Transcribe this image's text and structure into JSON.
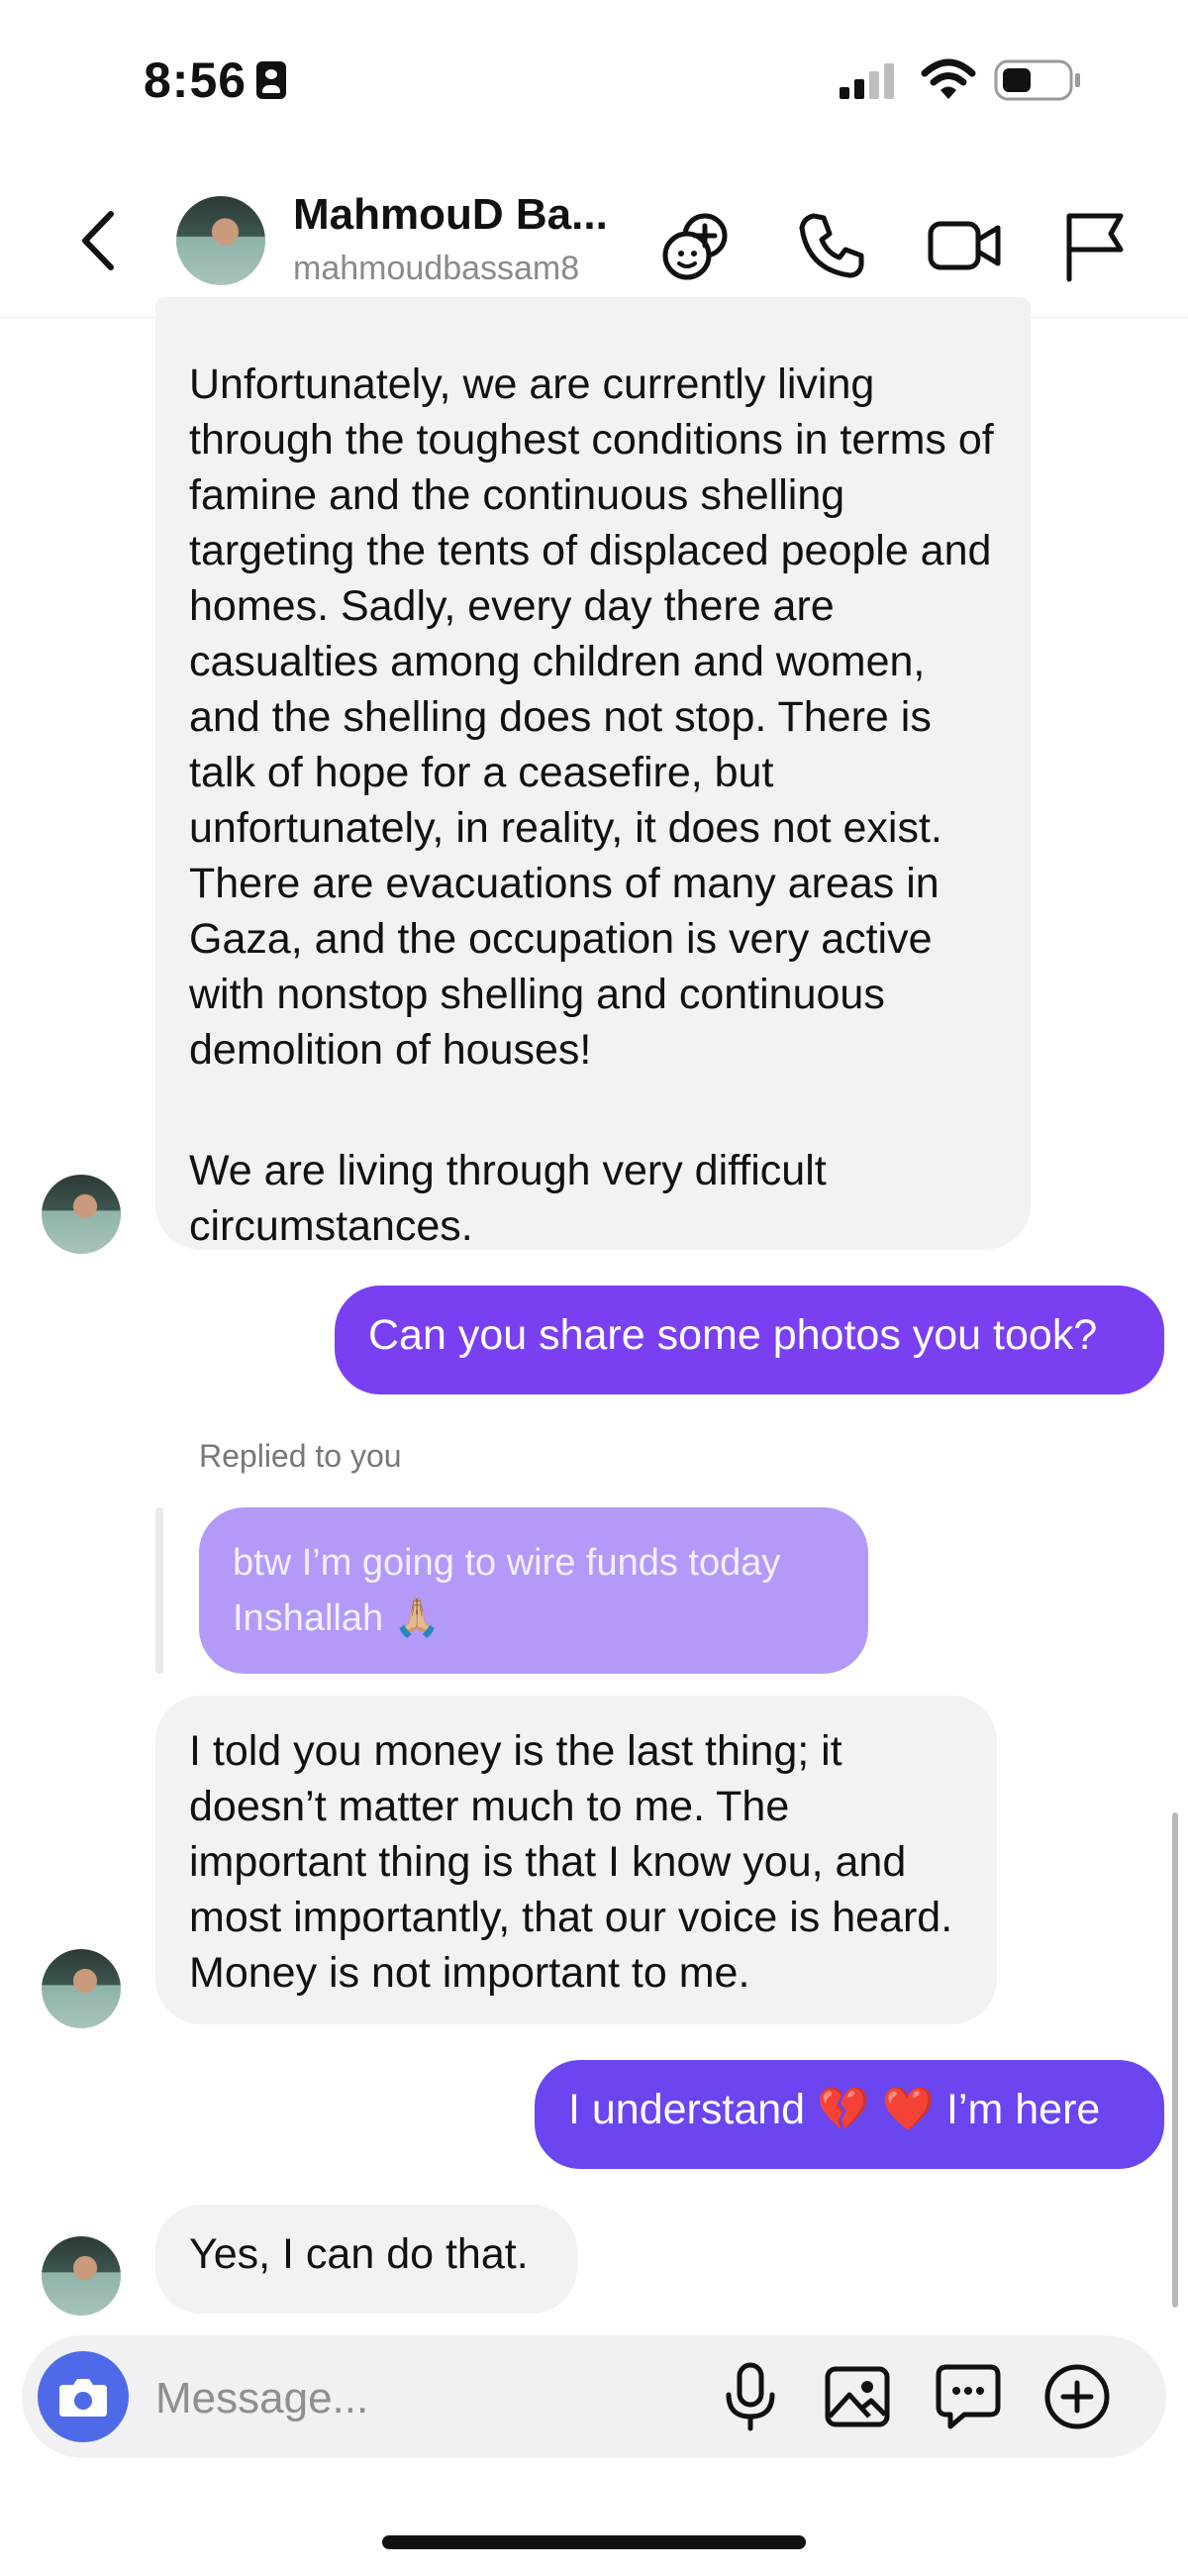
{
  "status_bar": {
    "time": "8:56"
  },
  "header": {
    "display_name": "MahmouD Ba...",
    "username": "mahmoudbassam8",
    "icons": [
      "back-chevron-icon",
      "add-person-icon",
      "phone-icon",
      "video-camera-icon",
      "flag-icon"
    ]
  },
  "messages": {
    "m1_p1": "Unfortunately, we are currently living through the toughest conditions in terms of famine and the continuous shelling targeting the tents of displaced people and homes. Sadly, every day there are casualties among children and women, and the shelling does not stop. There is talk of hope for a ceasefire, but unfortunately, in reality, it does not exist. There are evacuations of many areas in Gaza, and the occupation is very active with nonstop shelling and continuous demolition of houses!",
    "m1_p2": "We are living through very difficult circumstances.",
    "m2": "Can you share some photos you took?",
    "reply_label": "Replied to you",
    "reply_quote": "btw I’m going to wire funds today Inshallah 🙏🏼",
    "m3": "I told you money is the last thing; it doesn’t matter much to me. The important thing is that I know you, and most importantly, that our voice is heard. Money is not important to me.",
    "m4": "I understand 💔 ❤️ I’m here",
    "m5": "Yes, I can do that."
  },
  "composer": {
    "placeholder": "Message...",
    "icons": [
      "camera-icon",
      "microphone-icon",
      "image-icon",
      "sticker-chat-icon",
      "plus-circle-icon"
    ]
  },
  "colors": {
    "outgoing_purple": "#7b3ff2",
    "outgoing_indigo": "#6a45f0",
    "incoming_gray": "#f2f2f4",
    "reply_lavender": "#b39af8",
    "camera_blue": "#4f6ae8"
  }
}
